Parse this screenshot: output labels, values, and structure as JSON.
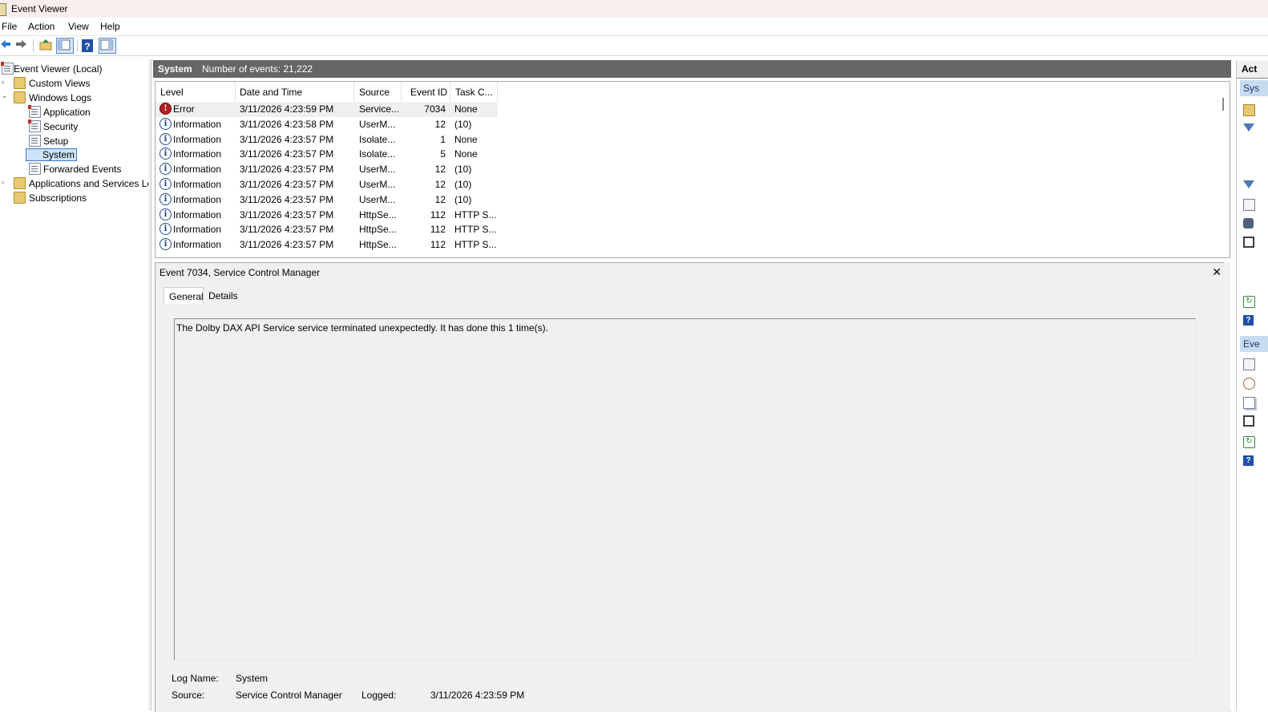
{
  "window": {
    "title": "Event Viewer"
  },
  "menu": {
    "items": [
      "File",
      "Action",
      "View",
      "Help"
    ]
  },
  "tree": {
    "root": "Event Viewer (Local)",
    "custom_views": "Custom Views",
    "windows_logs": "Windows Logs",
    "application": "Application",
    "security": "Security",
    "setup": "Setup",
    "system": "System",
    "forwarded_events": "Forwarded Events",
    "apps_services": "Applications and Services Lo",
    "subscriptions": "Subscriptions"
  },
  "center_header": {
    "title": "System",
    "count": "Number of events: 21,222"
  },
  "event_list": {
    "columns": [
      "Level",
      "Date and Time",
      "Source",
      "Event ID",
      "Task C..."
    ],
    "rows": [
      {
        "level": "Error",
        "date": "3/11/2026 4:23:59 PM",
        "source": "Service...",
        "id": "7034",
        "task": "None"
      },
      {
        "level": "Information",
        "date": "3/11/2026 4:23:58 PM",
        "source": "UserM...",
        "id": "12",
        "task": "(10)"
      },
      {
        "level": "Information",
        "date": "3/11/2026 4:23:57 PM",
        "source": "Isolate...",
        "id": "1",
        "task": "None"
      },
      {
        "level": "Information",
        "date": "3/11/2026 4:23:57 PM",
        "source": "Isolate...",
        "id": "5",
        "task": "None"
      },
      {
        "level": "Information",
        "date": "3/11/2026 4:23:57 PM",
        "source": "UserM...",
        "id": "12",
        "task": "(10)"
      },
      {
        "level": "Information",
        "date": "3/11/2026 4:23:57 PM",
        "source": "UserM...",
        "id": "12",
        "task": "(10)"
      },
      {
        "level": "Information",
        "date": "3/11/2026 4:23:57 PM",
        "source": "UserM...",
        "id": "12",
        "task": "(10)"
      },
      {
        "level": "Information",
        "date": "3/11/2026 4:23:57 PM",
        "source": "HttpSe...",
        "id": "112",
        "task": "HTTP S..."
      },
      {
        "level": "Information",
        "date": "3/11/2026 4:23:57 PM",
        "source": "HttpSe...",
        "id": "112",
        "task": "HTTP S..."
      },
      {
        "level": "Information",
        "date": "3/11/2026 4:23:57 PM",
        "source": "HttpSe...",
        "id": "112",
        "task": "HTTP S..."
      }
    ]
  },
  "detail": {
    "title": "Event 7034, Service Control Manager",
    "close": "✕",
    "tabs": {
      "general": "General",
      "details": "Details"
    },
    "message": "The Dolby DAX API Service service terminated unexpectedly.  It has done this 1 time(s).",
    "log_name_label": "Log Name:",
    "log_name_value": "System",
    "source_label": "Source:",
    "source_value": "Service Control Manager",
    "logged_label": "Logged:",
    "logged_value": "3/11/2026 4:23:59 PM"
  },
  "actions": {
    "header": "Act",
    "section1": "Sys",
    "section2": "Eve"
  }
}
